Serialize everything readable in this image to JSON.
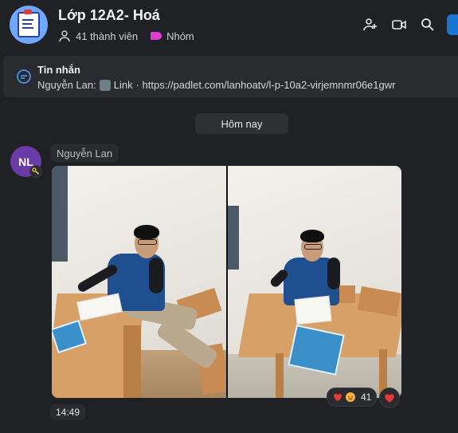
{
  "header": {
    "title": "Lớp 12A2- Hoá",
    "member_count": "41 thành viên",
    "group_label": "Nhóm",
    "actions": [
      {
        "icon": "add-member-icon"
      },
      {
        "icon": "video-call-icon"
      },
      {
        "icon": "search-icon"
      }
    ]
  },
  "pinned": {
    "title": "Tin nhắn",
    "sender": "Nguyễn Lan:",
    "link_label": "Link",
    "text": "· https://padlet.com/lanhoatv/l-p-10a2-virjemnmr06e1gwr",
    "icon": "chat-icon"
  },
  "chat": {
    "date_divider": "Hôm nay",
    "sender_initials": "NL",
    "sender_name": "Nguyễn Lan",
    "reaction_count": "41",
    "reaction_emojis": [
      "heart-emoji",
      "laughing-emoji"
    ],
    "react_button_emoji": "heart-emoji",
    "time": "14:49"
  },
  "colors": {
    "background": "#202124",
    "panel": "#2a2b2f",
    "accent_blue": "#1976d2",
    "avatar_purple": "#6a3aa6",
    "group_tag": "#e23bd1"
  }
}
